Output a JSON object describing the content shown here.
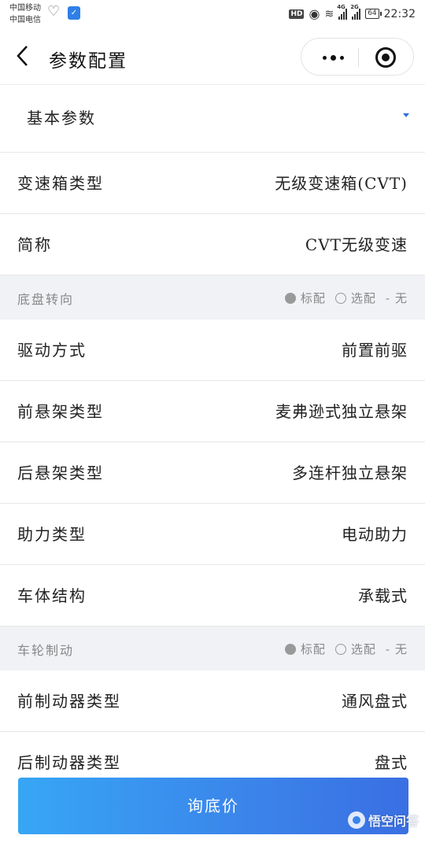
{
  "status_bar": {
    "carrier_1": "中国移动",
    "carrier_2": "中国电信",
    "hd": "HD",
    "network_1": "4G",
    "network_2": "2G",
    "battery": "64",
    "time": "22:32"
  },
  "nav": {
    "title": "参数配置"
  },
  "category": {
    "label": "基本参数"
  },
  "rows_basic": [
    {
      "label": "变速箱类型",
      "value": "无级变速箱(CVT)"
    },
    {
      "label": "简称",
      "value": "CVT无级变速"
    }
  ],
  "section_chassis": {
    "title": "底盘转向",
    "legend": {
      "standard": "标配",
      "optional": "选配",
      "dash": "-",
      "none": "无"
    }
  },
  "rows_chassis": [
    {
      "label": "驱动方式",
      "value": "前置前驱"
    },
    {
      "label": "前悬架类型",
      "value": "麦弗逊式独立悬架"
    },
    {
      "label": "后悬架类型",
      "value": "多连杆独立悬架"
    },
    {
      "label": "助力类型",
      "value": "电动助力"
    },
    {
      "label": "车体结构",
      "value": "承载式"
    }
  ],
  "section_brake": {
    "title": "车轮制动",
    "legend": {
      "standard": "标配",
      "optional": "选配",
      "dash": "-",
      "none": "无"
    }
  },
  "rows_brake": [
    {
      "label": "前制动器类型",
      "value": "通风盘式"
    },
    {
      "label": "后制动器类型",
      "value": "盘式"
    }
  ],
  "cta": {
    "label": "询底价"
  },
  "watermark": {
    "text": "悟空问答"
  },
  "colors": {
    "accent_blue": "#3b84ea",
    "section_bg": "#f1f2f6"
  }
}
